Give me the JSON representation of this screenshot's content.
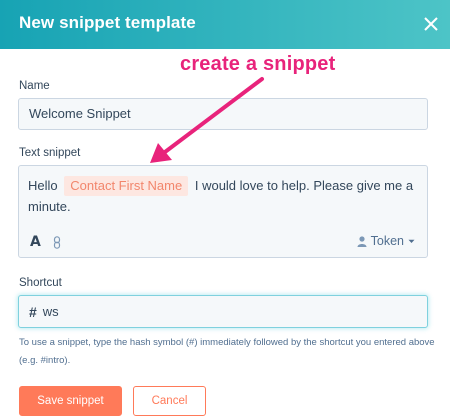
{
  "dialog": {
    "title": "New snippet template",
    "close_icon": "close-icon"
  },
  "name_field": {
    "label": "Name",
    "value": "Welcome Snippet"
  },
  "snippet_field": {
    "label": "Text snippet",
    "text_before": "Hello ",
    "token": "Contact First Name",
    "text_after": " I would love to help. Please give me a minute.",
    "format_label": "A",
    "link_icon": "link-icon",
    "token_button": "Token",
    "person_icon": "person-icon"
  },
  "shortcut_field": {
    "label": "Shortcut",
    "prefix": "#",
    "value": "ws",
    "help": "To use a snippet, type the hash symbol (#) immediately followed by the shortcut you entered above (e.g. #intro)."
  },
  "buttons": {
    "save": "Save snippet",
    "cancel": "Cancel"
  },
  "annotation": {
    "text": "create a snippet",
    "color": "#e8237b"
  },
  "colors": {
    "header_start": "#17a3b4",
    "header_end": "#4dc4c7",
    "accent": "#ff7a59",
    "token_bg": "#fde7e1"
  }
}
